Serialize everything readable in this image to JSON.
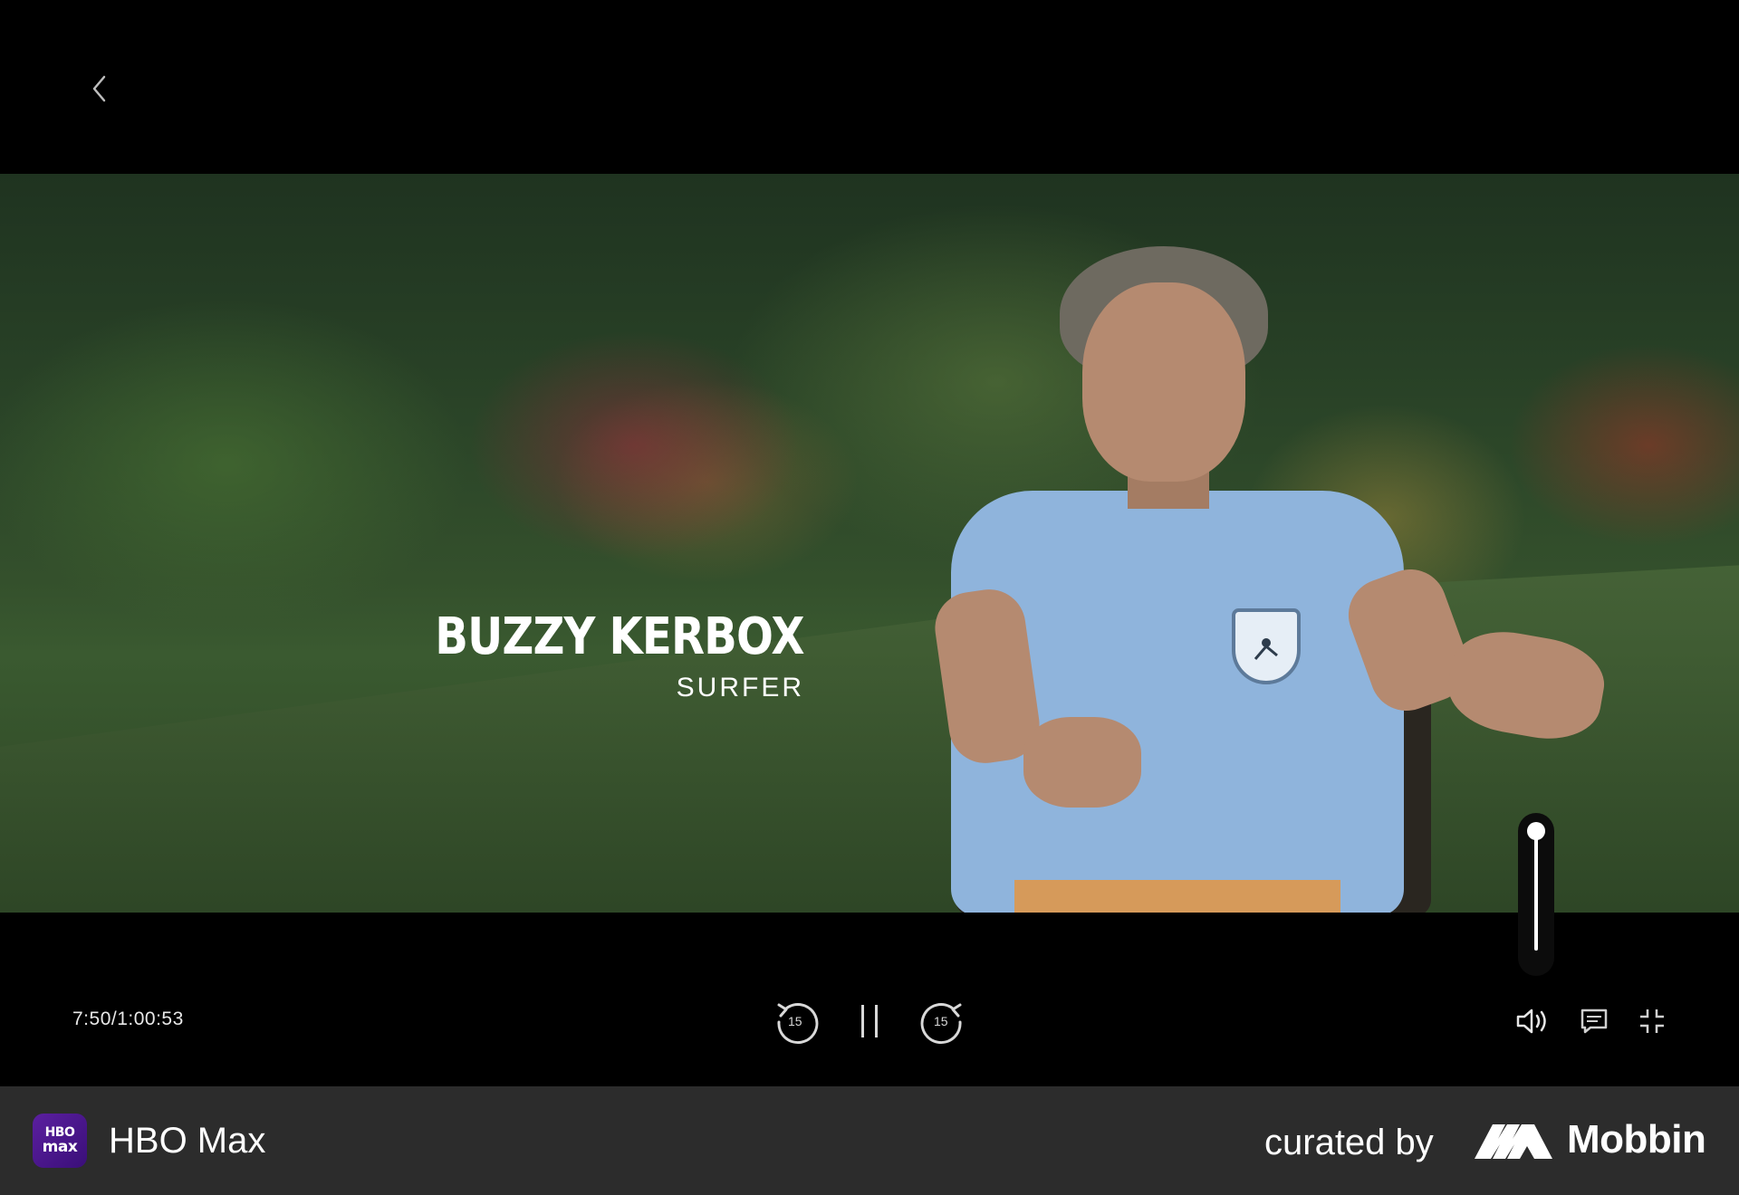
{
  "player": {
    "back_label": "Back",
    "lower_third": {
      "name": "BUZZY KERBOX",
      "role": "SURFER"
    },
    "time": {
      "current": "7:50",
      "total": "1:00:53",
      "display": "7:50/1:00:53"
    },
    "volume": {
      "level": 1.0
    },
    "controls": {
      "rewind_seconds": "15",
      "forward_seconds": "15",
      "icons": [
        "rewind-15-icon",
        "pause-icon",
        "forward-15-icon",
        "volume-icon",
        "subtitles-icon",
        "exit-fullscreen-icon"
      ]
    }
  },
  "footer": {
    "app_icon_line1": "HBO",
    "app_icon_line2": "max",
    "app_name": "HBO Max",
    "curated_by": "curated by",
    "brand": "Mobbin"
  },
  "colors": {
    "background": "#000000",
    "footer_bg": "#2c2c2c",
    "app_icon": "#4b1890",
    "shirt": "#8fb4dc",
    "text": "#ffffff"
  }
}
